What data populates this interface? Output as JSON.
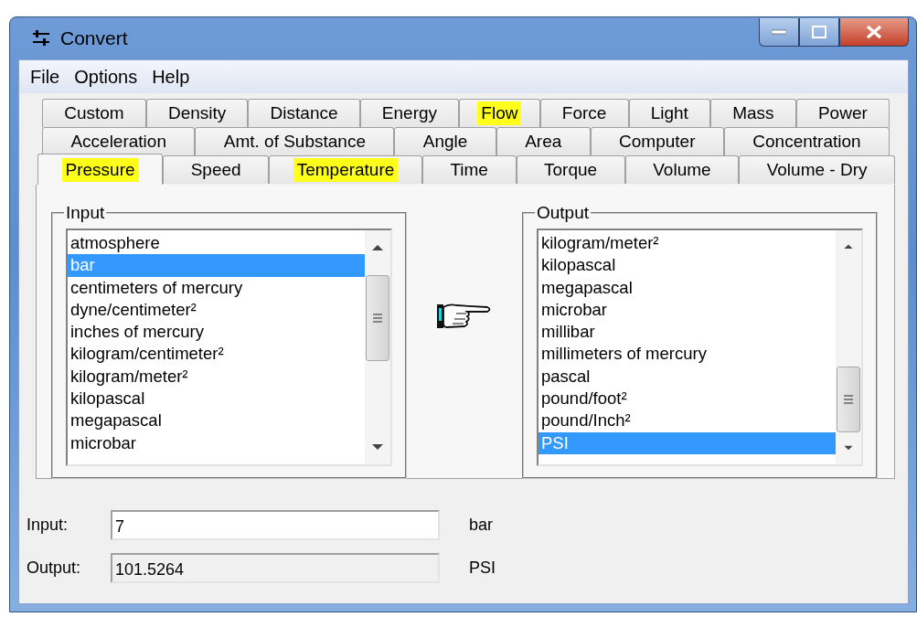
{
  "window": {
    "title": "Convert"
  },
  "menu": [
    "File",
    "Options",
    "Help"
  ],
  "tab_rows": [
    [
      {
        "label": "Custom",
        "selected": false,
        "highlighted": false
      },
      {
        "label": "Density",
        "selected": false,
        "highlighted": false
      },
      {
        "label": "Distance",
        "selected": false,
        "highlighted": false
      },
      {
        "label": "Energy",
        "selected": false,
        "highlighted": false
      },
      {
        "label": "Flow",
        "selected": false,
        "highlighted": true
      },
      {
        "label": "Force",
        "selected": false,
        "highlighted": false
      },
      {
        "label": "Light",
        "selected": false,
        "highlighted": false
      },
      {
        "label": "Mass",
        "selected": false,
        "highlighted": false
      },
      {
        "label": "Power",
        "selected": false,
        "highlighted": false
      }
    ],
    [
      {
        "label": "Acceleration",
        "selected": false,
        "highlighted": false
      },
      {
        "label": "Amt. of Substance",
        "selected": false,
        "highlighted": false
      },
      {
        "label": "Angle",
        "selected": false,
        "highlighted": false
      },
      {
        "label": "Area",
        "selected": false,
        "highlighted": false
      },
      {
        "label": "Computer",
        "selected": false,
        "highlighted": false
      },
      {
        "label": "Concentration",
        "selected": false,
        "highlighted": false
      }
    ],
    [
      {
        "label": "Pressure",
        "selected": true,
        "highlighted": true
      },
      {
        "label": "Speed",
        "selected": false,
        "highlighted": false
      },
      {
        "label": "Temperature",
        "selected": false,
        "highlighted": true
      },
      {
        "label": "Time",
        "selected": false,
        "highlighted": false
      },
      {
        "label": "Torque",
        "selected": false,
        "highlighted": false
      },
      {
        "label": "Volume",
        "selected": false,
        "highlighted": false
      },
      {
        "label": "Volume - Dry",
        "selected": false,
        "highlighted": false
      }
    ]
  ],
  "input_list": {
    "title": "Input",
    "items": [
      {
        "label": "atmosphere",
        "selected": false
      },
      {
        "label": "bar",
        "selected": true
      },
      {
        "label": "centimeters of mercury",
        "selected": false
      },
      {
        "label": "dyne/centimeter²",
        "selected": false
      },
      {
        "label": "inches of mercury",
        "selected": false
      },
      {
        "label": "kilogram/centimeter²",
        "selected": false
      },
      {
        "label": "kilogram/meter²",
        "selected": false
      },
      {
        "label": "kilopascal",
        "selected": false
      },
      {
        "label": "megapascal",
        "selected": false
      },
      {
        "label": "microbar",
        "selected": false
      }
    ]
  },
  "output_list": {
    "title": "Output",
    "items": [
      {
        "label": "kilogram/meter²",
        "selected": false
      },
      {
        "label": "kilopascal",
        "selected": false
      },
      {
        "label": "megapascal",
        "selected": false
      },
      {
        "label": "microbar",
        "selected": false
      },
      {
        "label": "millibar",
        "selected": false
      },
      {
        "label": "millimeters of mercury",
        "selected": false
      },
      {
        "label": "pascal",
        "selected": false
      },
      {
        "label": "pound/foot²",
        "selected": false
      },
      {
        "label": "pound/Inch²",
        "selected": false
      },
      {
        "label": "PSI",
        "selected": true
      }
    ]
  },
  "fields": [
    {
      "label": "Input:",
      "value": "7",
      "unit": "bar",
      "disabled": false
    },
    {
      "label": "Output:",
      "value": "101.5264",
      "unit": "PSI",
      "disabled": true
    }
  ]
}
